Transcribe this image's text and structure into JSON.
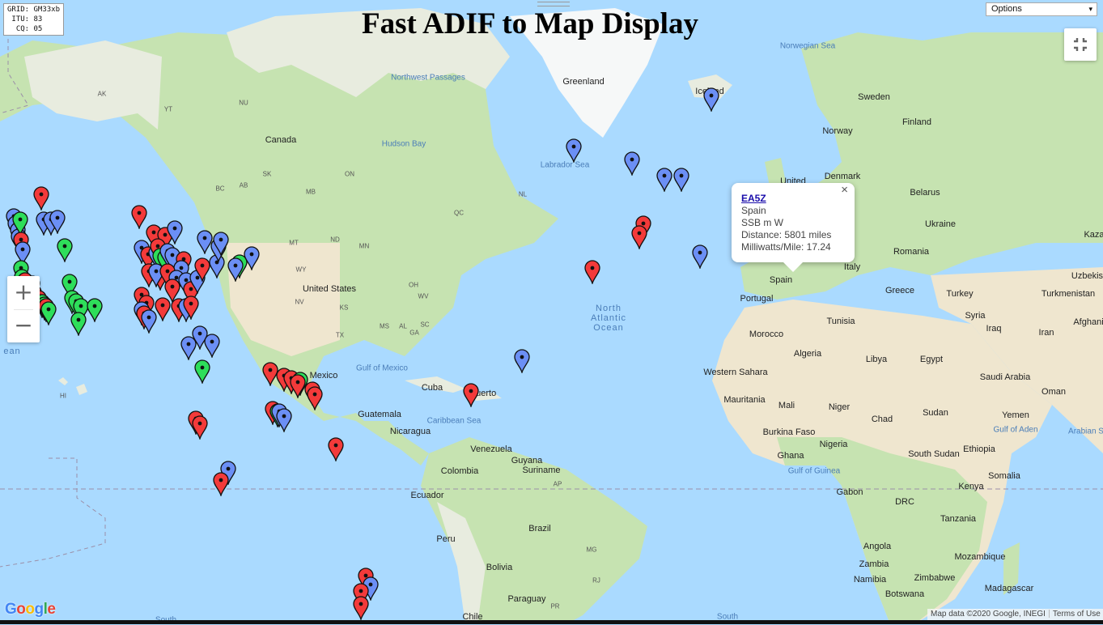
{
  "app": {
    "title": "Fast ADIF to Map Display",
    "grid_info": "GRID: GM33xb\n ITU: 83\n  CQ: 05",
    "options_label": "Options",
    "options_chevron": "▾",
    "zoom_in": "+",
    "zoom_out": "−"
  },
  "popup": {
    "callsign": "EA5Z",
    "country": "Spain",
    "mode": "SSB m W",
    "distance": "Distance: 5801 miles",
    "mw_per_mile": "Milliwatts/Mile: 17.24",
    "close_glyph": "×"
  },
  "attribution": {
    "map_data": "Map data ©2020 Google, INEGI",
    "terms": "Terms of Use"
  },
  "google_logo": [
    "G",
    "o",
    "o",
    "g",
    "l",
    "e"
  ],
  "colors": {
    "ocean": "#aadaff",
    "land": "#e8ecdf",
    "forest": "#c6e3b1",
    "desert": "#efe6cf",
    "ice": "#f6f8f8",
    "pin_red": "#f33a3a",
    "pin_blue": "#6b8ff5",
    "pin_green": "#2ede5a",
    "logo": [
      "#4285f4",
      "#ea4335",
      "#fbbc05",
      "#4285f4",
      "#34a853",
      "#ea4335"
    ]
  },
  "map_labels": {
    "countries": [
      "Canada",
      "United States",
      "Mexico",
      "Cuba",
      "Venezuela",
      "Colombia",
      "Guyana",
      "Suriname",
      "Ecuador",
      "Peru",
      "Brazil",
      "Bolivia",
      "Paraguay",
      "Chile",
      "Guatemala",
      "Nicaragua",
      "Greenland",
      "Iceland",
      "Norway",
      "Sweden",
      "Finland",
      "United",
      "Denmark",
      "Belarus",
      "Ukraine",
      "Romania",
      "Italy",
      "Greece",
      "Turkey",
      "Spain",
      "Portugal",
      "Morocco",
      "Algeria",
      "Libya",
      "Egypt",
      "Western Sahara",
      "Mauritania",
      "Mali",
      "Niger",
      "Chad",
      "Sudan",
      "Burkina Faso",
      "Nigeria",
      "Ghana",
      "Gabon",
      "Ethiopia",
      "South Sudan",
      "Kenya",
      "Somalia",
      "Tanzania",
      "DRC",
      "Angola",
      "Zambia",
      "Mozambique",
      "Madagascar",
      "Namibia",
      "Zimbabwe",
      "Botswana",
      "Syria",
      "Iraq",
      "Iran",
      "Saudi Arabia",
      "Oman",
      "Yemen",
      "Afghani",
      "Turkmenistan",
      "Uzbekist",
      "Kaza",
      "Tunisia",
      "Puerto"
    ],
    "states": [
      "AK",
      "YT",
      "NU",
      "BC",
      "AB",
      "SK",
      "MB",
      "ON",
      "QC",
      "NL",
      "MT",
      "ND",
      "MN",
      "WA",
      "OR",
      "WY",
      "NV",
      "KS",
      "TX",
      "OH",
      "WV",
      "SC",
      "MS",
      "AL",
      "GA",
      "HI",
      "AP",
      "MG",
      "RJ",
      "PR"
    ],
    "seas": [
      "Norwegian Sea",
      "Hudson Bay",
      "Labrador Sea",
      "Northwest Passages",
      "Gulf of Mexico",
      "Caribbean Sea",
      "Gulf of Guinea",
      "Gulf of Aden",
      "Arabian S",
      "North Atlantic Ocean",
      "ean",
      "South",
      "South"
    ]
  },
  "pins": [
    {
      "c": "green",
      "lon": -150,
      "lat": 64
    },
    {
      "c": "red",
      "lon": -118,
      "lat": 51
    },
    {
      "c": "blue",
      "lon": -124,
      "lat": 48
    },
    {
      "c": "blue",
      "lon": -123.5,
      "lat": 47
    },
    {
      "c": "blue",
      "lon": -123,
      "lat": 46
    },
    {
      "c": "blue",
      "lon": -122.8,
      "lat": 45
    },
    {
      "c": "green",
      "lon": -122.6,
      "lat": 47.6
    },
    {
      "c": "red",
      "lon": -122.4,
      "lat": 44.5
    },
    {
      "c": "blue",
      "lon": -122,
      "lat": 43
    },
    {
      "c": "blue",
      "lon": -117.5,
      "lat": 47.5
    },
    {
      "c": "blue",
      "lon": -116,
      "lat": 47.6
    },
    {
      "c": "blue",
      "lon": -114.5,
      "lat": 47.8
    },
    {
      "c": "green",
      "lon": -113,
      "lat": 43.5
    },
    {
      "c": "green",
      "lon": -122.4,
      "lat": 40
    },
    {
      "c": "green",
      "lon": -122.1,
      "lat": 38.6
    },
    {
      "c": "red",
      "lon": -121.5,
      "lat": 38
    },
    {
      "c": "red",
      "lon": -121,
      "lat": 37.3
    },
    {
      "c": "green",
      "lon": -120,
      "lat": 37.5
    },
    {
      "c": "red",
      "lon": -119.5,
      "lat": 36
    },
    {
      "c": "red",
      "lon": -118.5,
      "lat": 35
    },
    {
      "c": "green",
      "lon": -117.9,
      "lat": 34.3
    },
    {
      "c": "green",
      "lon": -117.3,
      "lat": 33.8
    },
    {
      "c": "red",
      "lon": -117,
      "lat": 33.5
    },
    {
      "c": "green",
      "lon": -116.5,
      "lat": 33
    },
    {
      "c": "green",
      "lon": -112,
      "lat": 37.8
    },
    {
      "c": "green",
      "lon": -111.5,
      "lat": 35
    },
    {
      "c": "green",
      "lon": -110.5,
      "lat": 34.4
    },
    {
      "c": "green",
      "lon": -109.5,
      "lat": 33.6
    },
    {
      "c": "green",
      "lon": -106.5,
      "lat": 33.5
    },
    {
      "c": "green",
      "lon": -110,
      "lat": 31
    },
    {
      "c": "red",
      "lon": -97,
      "lat": 48.5
    },
    {
      "c": "red",
      "lon": -94,
      "lat": 45.6
    },
    {
      "c": "red",
      "lon": -91.5,
      "lat": 45.3
    },
    {
      "c": "blue",
      "lon": -89.5,
      "lat": 46.3
    },
    {
      "c": "blue",
      "lon": -96.5,
      "lat": 43.3
    },
    {
      "c": "red",
      "lon": -95.2,
      "lat": 42.3
    },
    {
      "c": "blue",
      "lon": -93.5,
      "lat": 42.5
    },
    {
      "c": "red",
      "lon": -93,
      "lat": 43.5
    },
    {
      "c": "green",
      "lon": -92.5,
      "lat": 42
    },
    {
      "c": "green",
      "lon": -91.5,
      "lat": 41.8
    },
    {
      "c": "blue",
      "lon": -91,
      "lat": 42.8
    },
    {
      "c": "blue",
      "lon": -90,
      "lat": 42.2
    },
    {
      "c": "red",
      "lon": -87.5,
      "lat": 41.5
    },
    {
      "c": "blue",
      "lon": -88,
      "lat": 40
    },
    {
      "c": "red",
      "lon": -95,
      "lat": 39.5
    },
    {
      "c": "red",
      "lon": -92.5,
      "lat": 39
    },
    {
      "c": "blue",
      "lon": -93.5,
      "lat": 39.5
    },
    {
      "c": "red",
      "lon": -91,
      "lat": 39.5
    },
    {
      "c": "blue",
      "lon": -89,
      "lat": 38.5
    },
    {
      "c": "blue",
      "lon": -87,
      "lat": 38
    },
    {
      "c": "red",
      "lon": -90,
      "lat": 37
    },
    {
      "c": "red",
      "lon": -86,
      "lat": 36.5
    },
    {
      "c": "blue",
      "lon": -84.5,
      "lat": 38.5
    },
    {
      "c": "red",
      "lon": -83.5,
      "lat": 40.5
    },
    {
      "c": "blue",
      "lon": -80.5,
      "lat": 41
    },
    {
      "c": "blue",
      "lon": -80,
      "lat": 43.5
    },
    {
      "c": "blue",
      "lon": -79.5,
      "lat": 44.5
    },
    {
      "c": "blue",
      "lon": -83,
      "lat": 44.8
    },
    {
      "c": "green",
      "lon": -75.5,
      "lat": 41
    },
    {
      "c": "blue",
      "lon": -76.5,
      "lat": 40.5
    },
    {
      "c": "blue",
      "lon": -73,
      "lat": 42.3
    },
    {
      "c": "red",
      "lon": -96.5,
      "lat": 35.5
    },
    {
      "c": "red",
      "lon": -95.5,
      "lat": 34.2
    },
    {
      "c": "blue",
      "lon": -96.5,
      "lat": 33
    },
    {
      "c": "red",
      "lon": -96,
      "lat": 32.3
    },
    {
      "c": "blue",
      "lon": -95,
      "lat": 31.5
    },
    {
      "c": "red",
      "lon": -92,
      "lat": 33.7
    },
    {
      "c": "red",
      "lon": -88.5,
      "lat": 33.5
    },
    {
      "c": "blue",
      "lon": -87,
      "lat": 33.6
    },
    {
      "c": "red",
      "lon": -86,
      "lat": 34
    },
    {
      "c": "blue",
      "lon": -84,
      "lat": 28.5
    },
    {
      "c": "blue",
      "lon": -81.5,
      "lat": 27
    },
    {
      "c": "blue",
      "lon": -86.5,
      "lat": 26.5
    },
    {
      "c": "green",
      "lon": -83.5,
      "lat": 22
    },
    {
      "c": "red",
      "lon": -69,
      "lat": 21.5
    },
    {
      "c": "red",
      "lon": -66,
      "lat": 20.3
    },
    {
      "c": "red",
      "lon": -64.5,
      "lat": 19.8
    },
    {
      "c": "green",
      "lon": -62.5,
      "lat": 19.5
    },
    {
      "c": "red",
      "lon": -63,
      "lat": 19
    },
    {
      "c": "red",
      "lon": -60,
      "lat": 17.5
    },
    {
      "c": "red",
      "lon": -59.5,
      "lat": 16.5
    },
    {
      "c": "red",
      "lon": -68.5,
      "lat": 13.5
    },
    {
      "c": "green",
      "lon": -67.5,
      "lat": 13
    },
    {
      "c": "blue",
      "lon": -67,
      "lat": 13
    },
    {
      "c": "blue",
      "lon": -66,
      "lat": 12
    },
    {
      "c": "red",
      "lon": -85,
      "lat": 11.5
    },
    {
      "c": "red",
      "lon": -84,
      "lat": 10.5
    },
    {
      "c": "red",
      "lon": -55,
      "lat": 5.8
    },
    {
      "c": "blue",
      "lon": -78,
      "lat": 0.8
    },
    {
      "c": "red",
      "lon": -79.5,
      "lat": -1.5
    },
    {
      "c": "red",
      "lon": -48.5,
      "lat": -21.5
    },
    {
      "c": "blue",
      "lon": -47.5,
      "lat": -23.3
    },
    {
      "c": "red",
      "lon": -49.5,
      "lat": -24.5
    },
    {
      "c": "red",
      "lon": -49.5,
      "lat": -27
    },
    {
      "c": "blue",
      "lon": -158,
      "lat": 21.5
    },
    {
      "c": "green",
      "lon": -157,
      "lat": 21
    },
    {
      "c": "green",
      "lon": -155.8,
      "lat": 20
    },
    {
      "c": "red",
      "lon": -26,
      "lat": 17.2
    },
    {
      "c": "blue",
      "lon": -15,
      "lat": 24
    },
    {
      "c": "blue",
      "lon": -4,
      "lat": 57
    },
    {
      "c": "blue",
      "lon": 8.5,
      "lat": 55.5
    },
    {
      "c": "blue",
      "lon": 15.5,
      "lat": 53.5
    },
    {
      "c": "blue",
      "lon": 19,
      "lat": 53.5
    },
    {
      "c": "red",
      "lon": 11,
      "lat": 47
    },
    {
      "c": "red",
      "lon": 10,
      "lat": 45.5
    },
    {
      "c": "blue",
      "lon": 23,
      "lat": 42.5
    },
    {
      "c": "blue",
      "lon": 25.5,
      "lat": 62.5
    },
    {
      "c": "red",
      "lon": 0,
      "lat": 40
    }
  ]
}
